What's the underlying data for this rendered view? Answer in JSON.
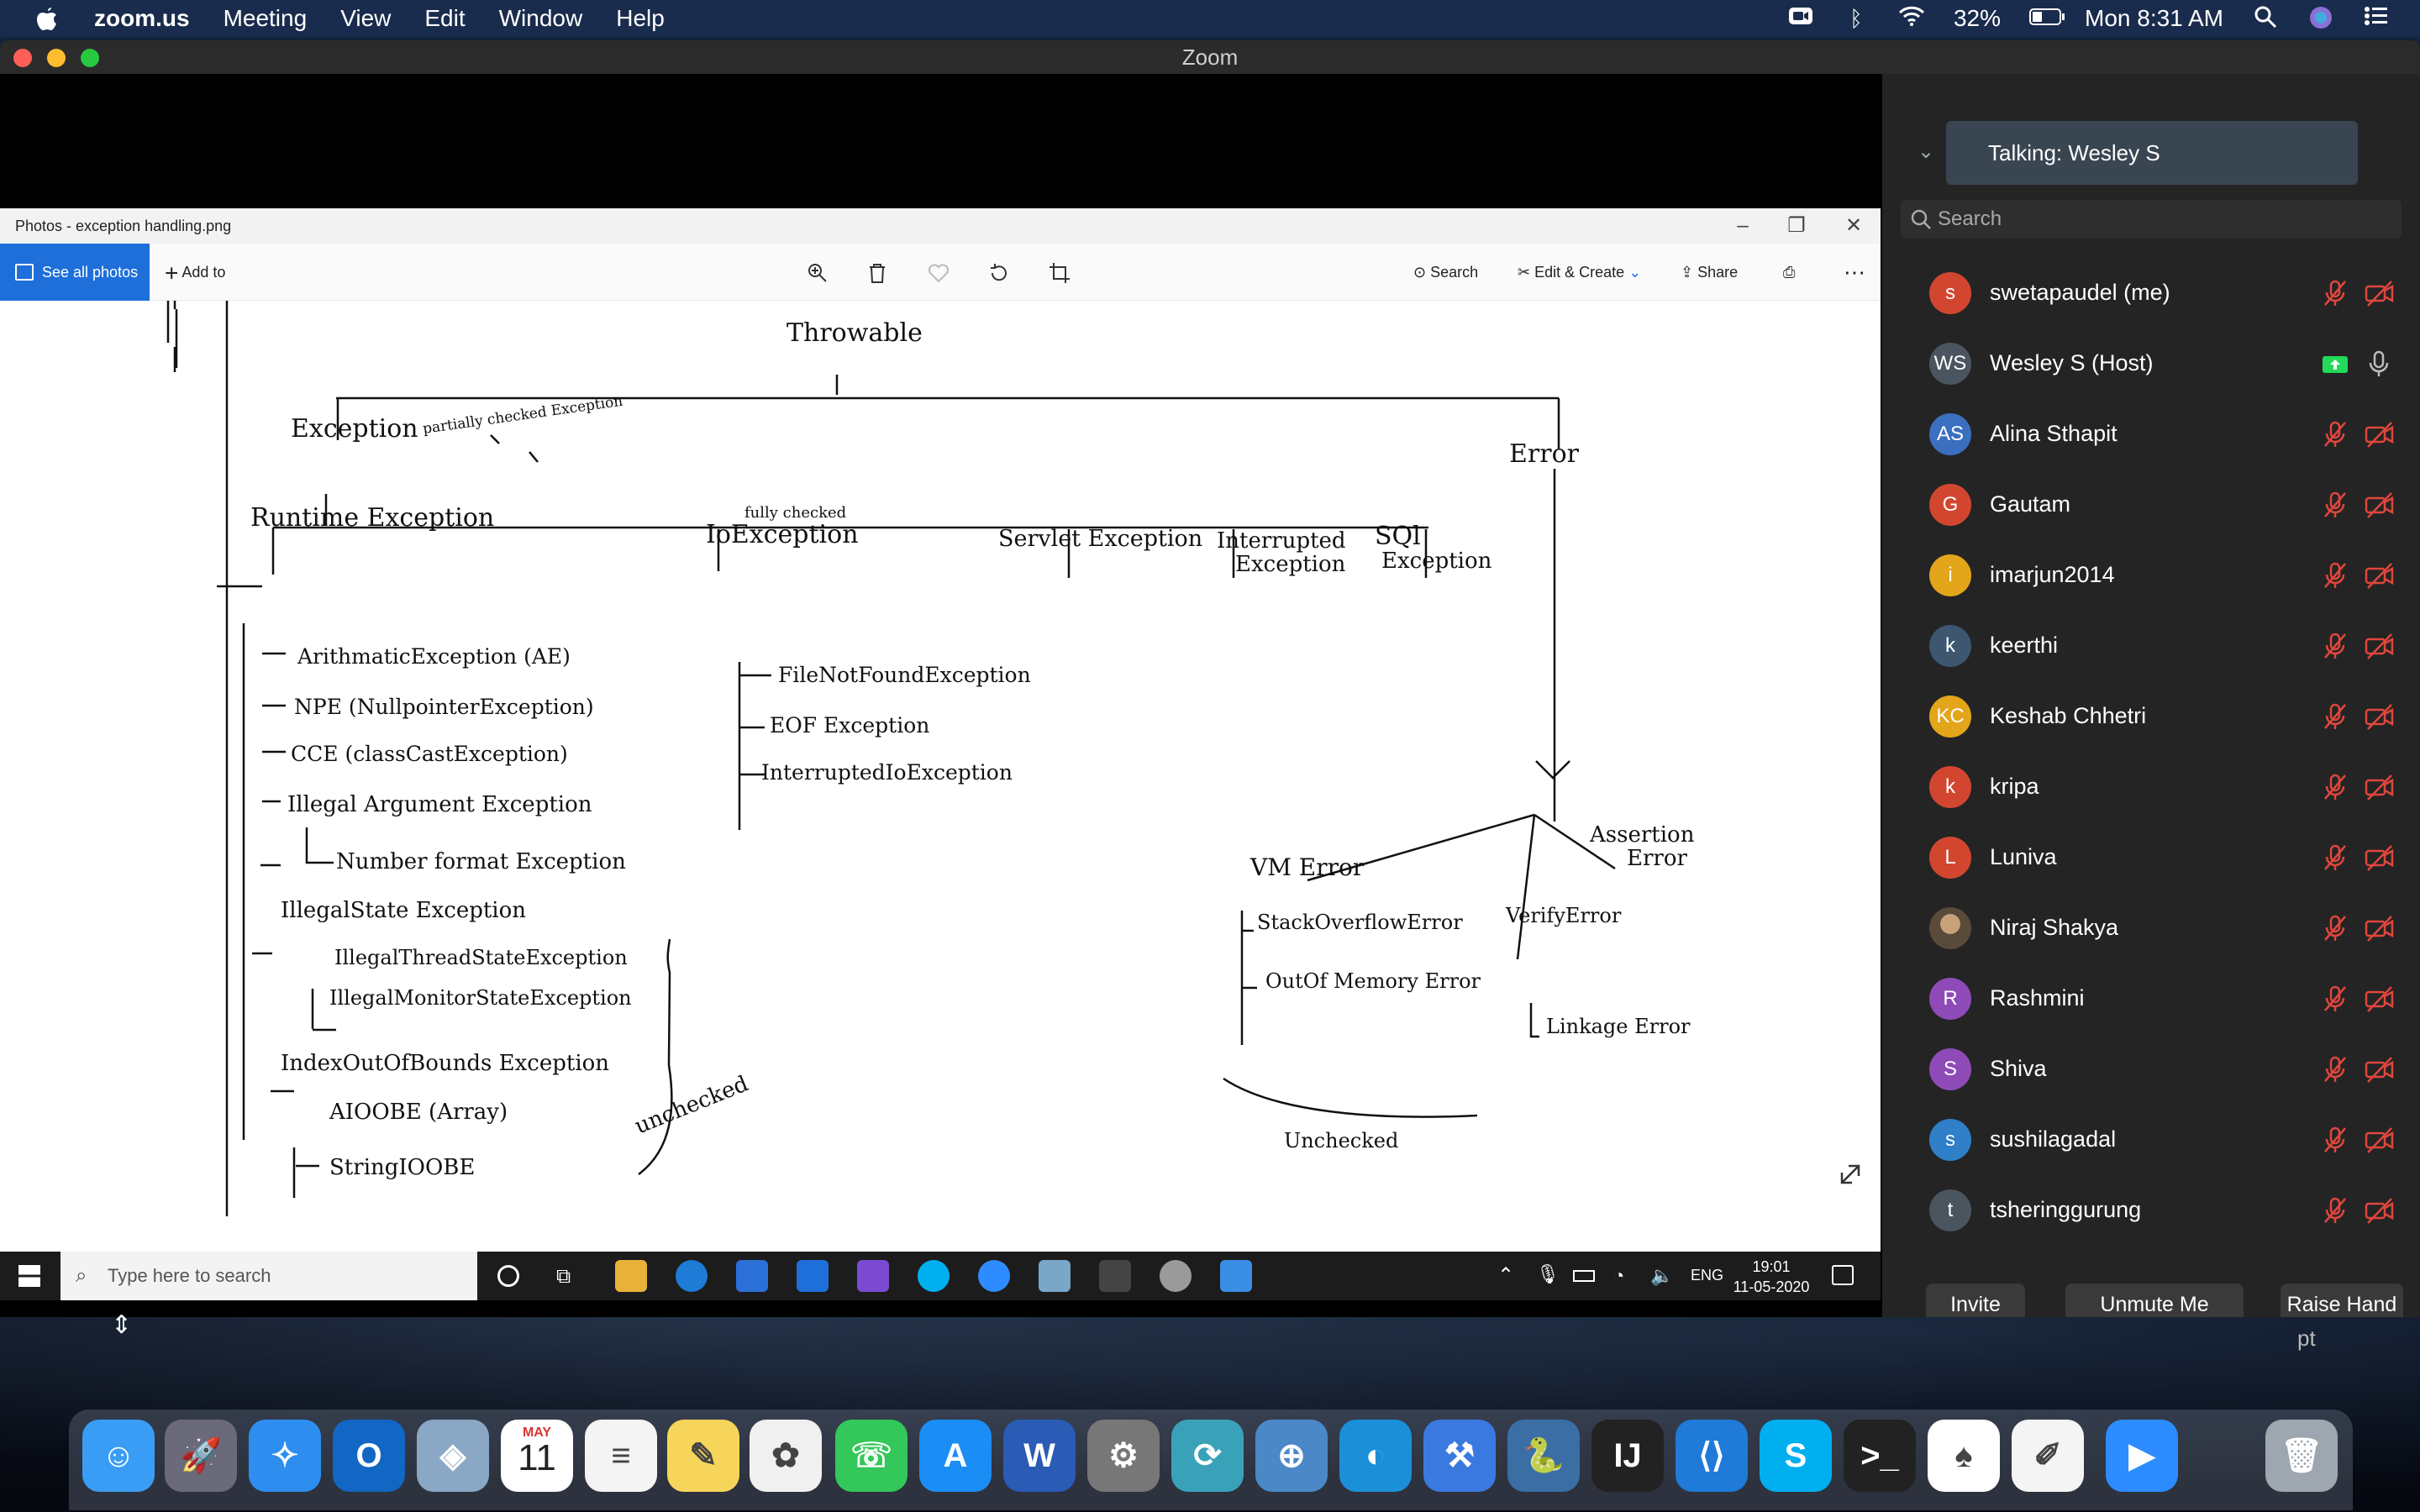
{
  "menubar": {
    "app": "zoom.us",
    "items": [
      "Meeting",
      "View",
      "Edit",
      "Window",
      "Help"
    ],
    "battery": "32%",
    "clock": "Mon 8:31 AM"
  },
  "window": {
    "title": "Zoom"
  },
  "photos": {
    "title": "Photos - exception handling.png",
    "see_all": "See all photos",
    "add_to": "Add to",
    "search": "Search",
    "edit_create": "Edit & Create",
    "share": "Share"
  },
  "diagram": {
    "root": "Throwable",
    "exception": "Exception",
    "partially": "partially checked Exception",
    "error": "Error",
    "runtime": "Runtime Exception",
    "io": "IoException",
    "fully": "fully checked",
    "servlet": "Servlet Exception",
    "interrupted1": "Interrupted",
    "interrupted2": "Exception",
    "sql1": "SQl",
    "sql2": "Exception",
    "ae": "ArithmaticException (AE)",
    "npe": "NPE (NullpointerException)",
    "cce": "CCE (classCastException)",
    "iae": "Illegal Argument Exception",
    "nfe": "Number format Exception",
    "ise": "IllegalState Exception",
    "itse": "IllegalThreadStateException",
    "imse": "IllegalMonitorStateException",
    "ioobe": "IndexOutOfBounds Exception",
    "aioobe": "AIOOBE (Array)",
    "sioobe": "StringIOOBE",
    "unchecked1": "unchecked",
    "fnf": "FileNotFoundException",
    "eof": "EOF Exception",
    "iioe": "InterruptedIoException",
    "vm": "VM Error",
    "soe": "StackOverflowError",
    "oom": "OutOf Memory Error",
    "verify": "VerifyError",
    "linkage": "Linkage Error",
    "assert1": "Assertion",
    "assert2": "Error",
    "unchecked2": "Unchecked"
  },
  "taskbar": {
    "search_placeholder": "Type here to search",
    "lang": "ENG",
    "time": "19:01",
    "date": "11-05-2020"
  },
  "sidebar": {
    "talking": "Talking: Wesley S",
    "search_placeholder": "Search",
    "participants": [
      {
        "initials": "s",
        "name": "swetapaudel (me)",
        "color": "#d2462f",
        "status": "muted"
      },
      {
        "initials": "WS",
        "name": "Wesley S (Host)",
        "color": "#4a5560",
        "status": "host"
      },
      {
        "initials": "AS",
        "name": "Alina Sthapit",
        "color": "#3b6fbf",
        "status": "muted"
      },
      {
        "initials": "G",
        "name": "Gautam",
        "color": "#d2462f",
        "status": "muted"
      },
      {
        "initials": "i",
        "name": "imarjun2014",
        "color": "#e3a51a",
        "status": "muted"
      },
      {
        "initials": "k",
        "name": "keerthi",
        "color": "#3e5670",
        "status": "muted"
      },
      {
        "initials": "KC",
        "name": "Keshab Chhetri",
        "color": "#e3a51a",
        "status": "muted"
      },
      {
        "initials": "k",
        "name": "kripa",
        "color": "#d2462f",
        "status": "muted"
      },
      {
        "initials": "L",
        "name": "Luniva",
        "color": "#d2462f",
        "status": "muted"
      },
      {
        "initials": "",
        "name": "Niraj Shakya",
        "color": "#7a6a5a",
        "status": "muted"
      },
      {
        "initials": "R",
        "name": "Rashmini",
        "color": "#8e4bb8",
        "status": "muted"
      },
      {
        "initials": "S",
        "name": "Shiva",
        "color": "#8e4bb8",
        "status": "muted"
      },
      {
        "initials": "s",
        "name": "sushilagadal",
        "color": "#2f7fc9",
        "status": "muted"
      },
      {
        "initials": "t",
        "name": "tsheringgurung",
        "color": "#4a5560",
        "status": "muted"
      }
    ],
    "buttons": {
      "invite": "Invite",
      "unmute": "Unmute Me",
      "raise": "Raise Hand"
    }
  },
  "desktop": {
    "fragment": "pt"
  },
  "dock": {
    "calendar_month": "MAY",
    "calendar_day": "11"
  }
}
